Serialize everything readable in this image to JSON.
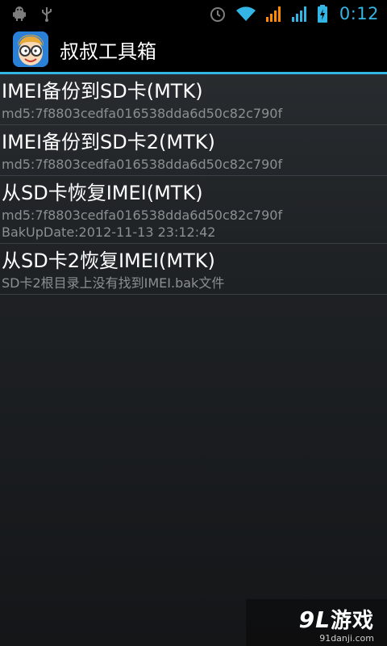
{
  "status_bar": {
    "time": "0:12",
    "icons": [
      "android-debug-icon",
      "usb-icon",
      "alarm-icon",
      "wifi-icon",
      "signal-icon",
      "signal-icon",
      "battery-charging-icon"
    ]
  },
  "action_bar": {
    "title": "叔叔工具箱",
    "icon": "app-face-icon"
  },
  "items": [
    {
      "title": "IMEI备份到SD卡(MTK)",
      "lines": [
        "md5:7f8803cedfa016538dda6d50c82c790f"
      ]
    },
    {
      "title": "IMEI备份到SD卡2(MTK)",
      "lines": [
        "md5:7f8803cedfa016538dda6d50c82c790f"
      ]
    },
    {
      "title": "从SD卡恢复IMEI(MTK)",
      "lines": [
        "md5:7f8803cedfa016538dda6d50c82c790f",
        "BakUpDate:2012-11-13 23:12:42"
      ]
    },
    {
      "title": "从SD卡2恢复IMEI(MTK)",
      "lines": [
        "SD卡2根目录上没有找到IMEI.bak文件"
      ]
    }
  ],
  "watermark": {
    "logo_num": "9L",
    "logo_text": "游戏",
    "url": "91danji.com"
  },
  "colors": {
    "accent": "#33b5e5",
    "title_text": "#ffffff",
    "secondary_text": "#8c8f92"
  }
}
